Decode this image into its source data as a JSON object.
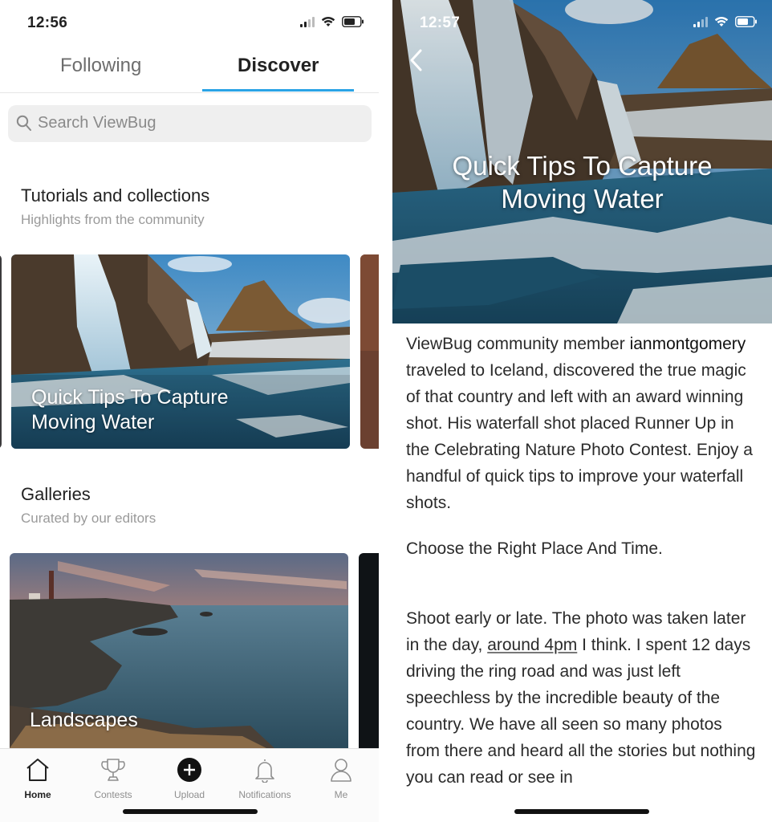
{
  "left": {
    "status": {
      "time": "12:56"
    },
    "tabs": {
      "following": "Following",
      "discover": "Discover"
    },
    "search": {
      "placeholder": "Search ViewBug"
    },
    "tutorials": {
      "title": "Tutorials and collections",
      "subtitle": "Highlights from the community",
      "card_title_line1": "Quick Tips To Capture",
      "card_title_line2": "Moving Water"
    },
    "galleries": {
      "title": "Galleries",
      "subtitle": "Curated by our editors",
      "card_title": "Landscapes"
    },
    "tabbar": {
      "home": "Home",
      "contests": "Contests",
      "upload": "Upload",
      "notifications": "Notifications",
      "me": "Me"
    }
  },
  "right": {
    "status": {
      "time": "12:57"
    },
    "hero_title_line1": "Quick Tips To Capture",
    "hero_title_line2": "Moving Water",
    "article": {
      "p1_a": "ViewBug community member",
      "p1_user": "ianmontgomery",
      "p1_b": "traveled to Iceland, discovered the true magic of that country and left with an award winning shot. His waterfall shot placed Runner Up in the Celebrating Nature Photo Contest. Enjoy a handful of quick tips to improve your waterfall shots.",
      "p2": "Choose the Right Place And Time.",
      "p3_a": "Shoot early or late. The photo was taken later in the day,",
      "p3_link": "around 4pm",
      "p3_b": "I think. I spent 12 days driving the ring road and was just left speechless by the incredible beauty of the country. We have all seen so many photos from there and heard all the stories but nothing you can read or see in"
    }
  },
  "colors": {
    "accent": "#2aa3e6",
    "text": "#222222",
    "muted": "#9a9a9a"
  }
}
